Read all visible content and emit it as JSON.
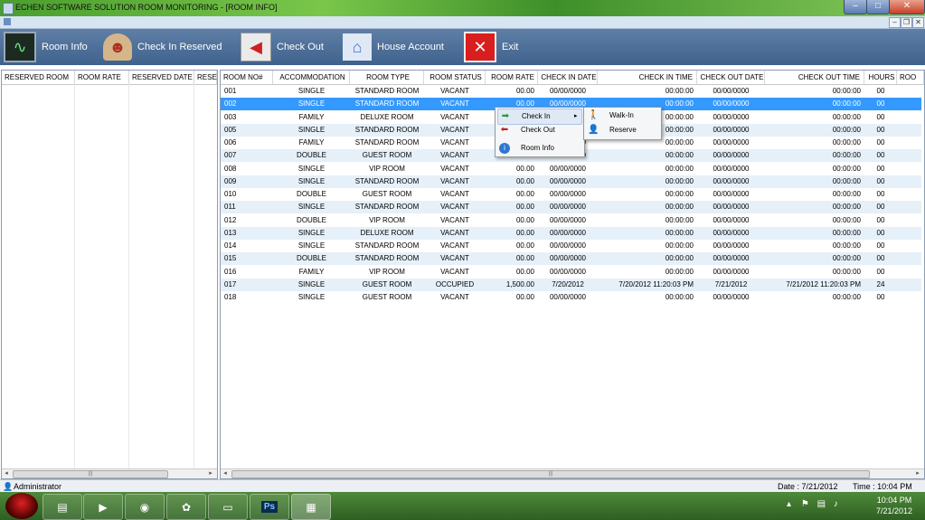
{
  "window": {
    "title": "ECHEN SOFTWARE SOLUTION ROOM MONITORING - [ROOM INFO]"
  },
  "toolbar": {
    "room_info": "Room Info",
    "check_in_reserved": "Check In Reserved",
    "check_out": "Check Out",
    "house_account": "House Account",
    "exit": "Exit"
  },
  "reserved": {
    "columns": [
      "RESERVED ROOM",
      "ROOM RATE",
      "RESERVED DATE",
      "RESE"
    ]
  },
  "rooms": {
    "columns": [
      "ROOM NO#",
      "ACCOMMODATION",
      "ROOM TYPE",
      "ROOM STATUS",
      "ROOM RATE",
      "CHECK IN DATE",
      "CHECK IN TIME",
      "CHECK OUT DATE",
      "CHECK OUT TIME",
      "HOURS",
      "ROO"
    ],
    "rows": [
      [
        "001",
        "SINGLE",
        "STANDARD ROOM",
        "VACANT",
        "00.00",
        "00/00/0000",
        "00:00:00",
        "00/00/0000",
        "00:00:00",
        "00"
      ],
      [
        "002",
        "SINGLE",
        "STANDARD ROOM",
        "VACANT",
        "00.00",
        "00/00/0000",
        "00:00:00",
        "00/00/0000",
        "00:00:00",
        "00"
      ],
      [
        "003",
        "FAMILY",
        "DELUXE ROOM",
        "VACANT",
        "00.00",
        "00/00/0000",
        "00:00:00",
        "00/00/0000",
        "00:00:00",
        "00"
      ],
      [
        "005",
        "SINGLE",
        "STANDARD ROOM",
        "VACANT",
        "00.00",
        "00/00/0000",
        "00:00:00",
        "00/00/0000",
        "00:00:00",
        "00"
      ],
      [
        "006",
        "FAMILY",
        "STANDARD ROOM",
        "VACANT",
        "00.00",
        "00/00/0000",
        "00:00:00",
        "00/00/0000",
        "00:00:00",
        "00"
      ],
      [
        "007",
        "DOUBLE",
        "GUEST ROOM",
        "VACANT",
        "00.00",
        "00/00/0000",
        "00:00:00",
        "00/00/0000",
        "00:00:00",
        "00"
      ],
      [
        "008",
        "SINGLE",
        "VIP ROOM",
        "VACANT",
        "00.00",
        "00/00/0000",
        "00:00:00",
        "00/00/0000",
        "00:00:00",
        "00"
      ],
      [
        "009",
        "SINGLE",
        "STANDARD ROOM",
        "VACANT",
        "00.00",
        "00/00/0000",
        "00:00:00",
        "00/00/0000",
        "00:00:00",
        "00"
      ],
      [
        "010",
        "DOUBLE",
        "GUEST ROOM",
        "VACANT",
        "00.00",
        "00/00/0000",
        "00:00:00",
        "00/00/0000",
        "00:00:00",
        "00"
      ],
      [
        "011",
        "SINGLE",
        "STANDARD ROOM",
        "VACANT",
        "00.00",
        "00/00/0000",
        "00:00:00",
        "00/00/0000",
        "00:00:00",
        "00"
      ],
      [
        "012",
        "DOUBLE",
        "VIP ROOM",
        "VACANT",
        "00.00",
        "00/00/0000",
        "00:00:00",
        "00/00/0000",
        "00:00:00",
        "00"
      ],
      [
        "013",
        "SINGLE",
        "DELUXE ROOM",
        "VACANT",
        "00.00",
        "00/00/0000",
        "00:00:00",
        "00/00/0000",
        "00:00:00",
        "00"
      ],
      [
        "014",
        "SINGLE",
        "STANDARD ROOM",
        "VACANT",
        "00.00",
        "00/00/0000",
        "00:00:00",
        "00/00/0000",
        "00:00:00",
        "00"
      ],
      [
        "015",
        "DOUBLE",
        "STANDARD ROOM",
        "VACANT",
        "00.00",
        "00/00/0000",
        "00:00:00",
        "00/00/0000",
        "00:00:00",
        "00"
      ],
      [
        "016",
        "FAMILY",
        "VIP ROOM",
        "VACANT",
        "00.00",
        "00/00/0000",
        "00:00:00",
        "00/00/0000",
        "00:00:00",
        "00"
      ],
      [
        "017",
        "SINGLE",
        "GUEST ROOM",
        "OCCUPIED",
        "1,500.00",
        "7/20/2012",
        "7/20/2012 11:20:03 PM",
        "7/21/2012",
        "7/21/2012 11:20:03 PM",
        "24"
      ],
      [
        "018",
        "SINGLE",
        "GUEST ROOM",
        "VACANT",
        "00.00",
        "00/00/0000",
        "00:00:00",
        "00/00/0000",
        "00:00:00",
        "00"
      ]
    ],
    "selected_row": 1
  },
  "context_menu": {
    "items": [
      "Check In",
      "Check Out",
      "Room Info"
    ],
    "submenu": [
      "Walk-In",
      "Reserve"
    ]
  },
  "status": {
    "user": "Administrator",
    "date": "Date : 7/21/2012",
    "time": "Time : 10:04 PM"
  },
  "taskbar": {
    "clock_time": "10:04 PM",
    "clock_date": "7/21/2012",
    "ps_label": "Ps"
  },
  "colors": {
    "toolbar": "#4a6d96",
    "selected_row": "#3399ff",
    "alt_row": "#e6f0f8"
  }
}
